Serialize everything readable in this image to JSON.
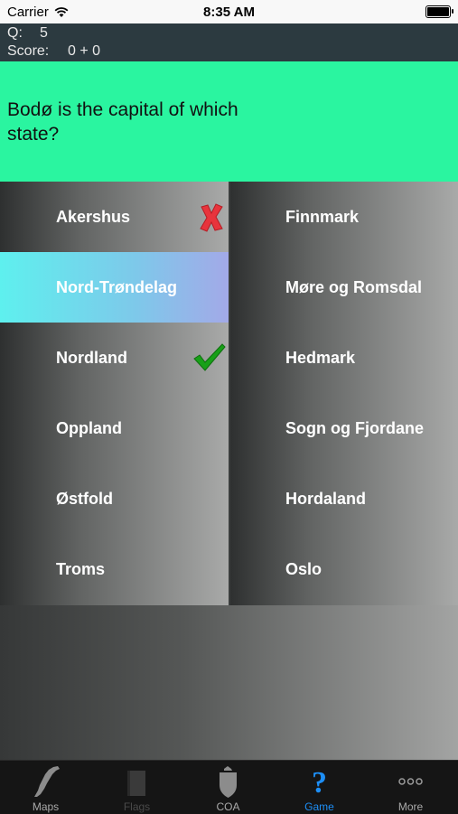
{
  "status_bar": {
    "carrier": "Carrier",
    "time": "8:35 AM"
  },
  "info": {
    "q_label": "Q:",
    "q_value": "5",
    "score_label": "Score:",
    "score_value": "0 + 0"
  },
  "question": {
    "text": "Bodø is the capital of which state?"
  },
  "answers": {
    "left": [
      {
        "label": "Akershus"
      },
      {
        "label": "Nord-Trøndelag",
        "state": "selected-wrong"
      },
      {
        "label": "Nordland",
        "state": "correct"
      },
      {
        "label": "Oppland"
      },
      {
        "label": "Østfold"
      },
      {
        "label": "Troms"
      }
    ],
    "right": [
      {
        "label": "Finnmark"
      },
      {
        "label": "Møre og Romsdal"
      },
      {
        "label": "Hedmark"
      },
      {
        "label": "Sogn og Fjordane"
      },
      {
        "label": "Hordaland"
      },
      {
        "label": "Oslo"
      }
    ]
  },
  "tabs": [
    {
      "label": "Maps",
      "icon": "map-icon"
    },
    {
      "label": "Flags",
      "icon": "flag-icon",
      "state": "disabled"
    },
    {
      "label": "COA",
      "icon": "coat-of-arms-icon"
    },
    {
      "label": "Game",
      "icon": "question-mark-icon",
      "state": "active"
    },
    {
      "label": "More",
      "icon": "more-icon"
    }
  ],
  "colors": {
    "question_bg": "#2af5a0",
    "selected_answer": "#5ef0ee",
    "active_tab": "#1d8ef5",
    "wrong_mark": "#e8343c",
    "check_mark": "#18a018"
  }
}
